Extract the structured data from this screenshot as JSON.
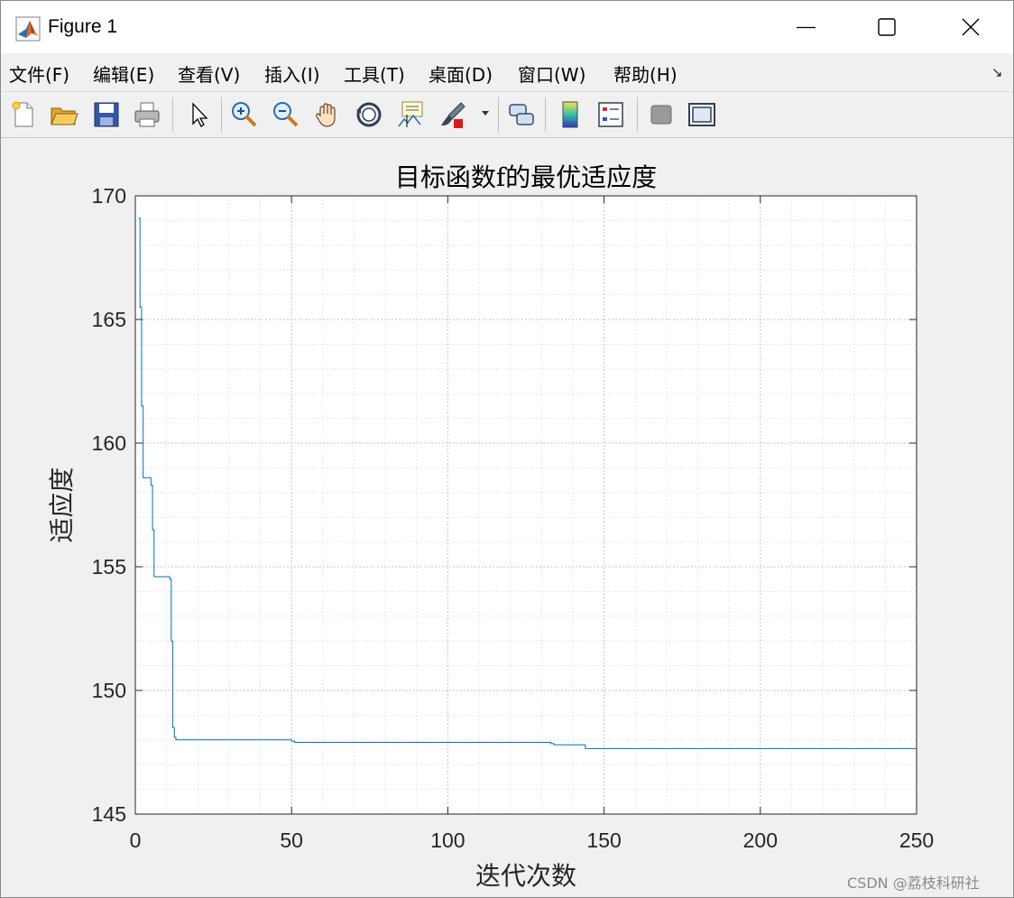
{
  "window": {
    "title": "Figure 1"
  },
  "menubar": {
    "items": [
      {
        "label": "文件(F)"
      },
      {
        "label": "编辑(E)"
      },
      {
        "label": "查看(V)"
      },
      {
        "label": "插入(I)"
      },
      {
        "label": "工具(T)"
      },
      {
        "label": "桌面(D)"
      },
      {
        "label": "窗口(W)"
      },
      {
        "label": "帮助(H)"
      }
    ],
    "dock_arrow": "↘"
  },
  "toolbar": {
    "icons": [
      "new-figure-icon",
      "open-file-icon",
      "save-icon",
      "print-icon",
      "select-arrow-icon",
      "zoom-in-icon",
      "zoom-out-icon",
      "pan-hand-icon",
      "rotate-3d-icon",
      "data-cursor-icon",
      "brush-icon",
      "link-plot-icon",
      "colorbar-icon",
      "legend-icon",
      "hide-plot-tools-icon",
      "show-plot-tools-icon"
    ]
  },
  "watermark": "CSDN @荔枝科研社",
  "chart_data": {
    "type": "line",
    "title": "目标函数f的最优适应度",
    "xlabel": "迭代次数",
    "ylabel": "适应度",
    "xlim": [
      0,
      250
    ],
    "ylim": [
      145,
      170
    ],
    "xticks": [
      0,
      50,
      100,
      150,
      200,
      250
    ],
    "yticks": [
      145,
      150,
      155,
      160,
      165,
      170
    ],
    "grid": true,
    "minor_grid": true,
    "line_color": "#0072BD",
    "series": [
      {
        "x": [
          1,
          1.5,
          2,
          2.5,
          3,
          4,
          5,
          5.5,
          6,
          7,
          10,
          11,
          11.5,
          12,
          12.5,
          13,
          14,
          48,
          49,
          50,
          51,
          80,
          132,
          133,
          134,
          143,
          144,
          145,
          250
        ],
        "y": [
          169.1,
          165.5,
          161.5,
          158.6,
          158.6,
          158.6,
          158.3,
          156.5,
          154.6,
          154.6,
          154.6,
          154.5,
          152,
          148.5,
          148.1,
          148.0,
          148.0,
          148.0,
          148.0,
          147.95,
          147.9,
          147.9,
          147.9,
          147.85,
          147.8,
          147.8,
          147.65,
          147.65,
          147.65
        ]
      }
    ]
  }
}
